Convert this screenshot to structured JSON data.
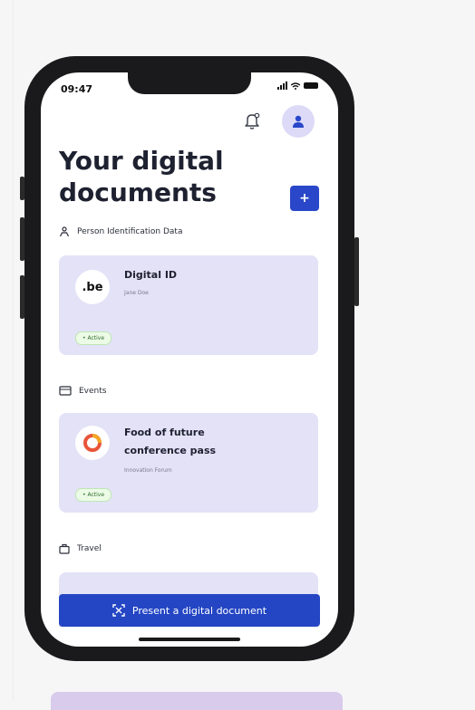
{
  "status_bar": {
    "time": "09:47"
  },
  "page": {
    "title_line1": "Your digital",
    "title_line2": "documents",
    "add_symbol": "+"
  },
  "sections": [
    {
      "label": "Person Identification Data"
    },
    {
      "label": "Events"
    },
    {
      "label": "Travel"
    }
  ],
  "cards": [
    {
      "logo_text": ".be",
      "title": "Digital ID",
      "subtitle": "Jane Doe",
      "status": "• Active"
    },
    {
      "title_line1": "Food of future",
      "title_line2": "conference pass",
      "subtitle": "Innovation Forum",
      "status": "• Active"
    }
  ],
  "present_button": {
    "label": "Present a digital document"
  },
  "colors": {
    "primary": "#2446c4",
    "card": "#e3e2f7",
    "avatar_bg": "#dcdaf7"
  }
}
